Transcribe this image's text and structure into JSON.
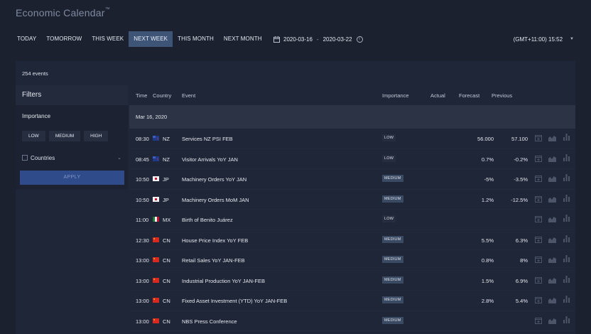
{
  "app": {
    "title": "Economic Calendar",
    "trademark": "™"
  },
  "period_tabs": [
    {
      "label": "TODAY",
      "active": false
    },
    {
      "label": "TOMORROW",
      "active": false
    },
    {
      "label": "THIS WEEK",
      "active": false
    },
    {
      "label": "NEXT WEEK",
      "active": true
    },
    {
      "label": "THIS MONTH",
      "active": false
    },
    {
      "label": "NEXT MONTH",
      "active": false
    }
  ],
  "date_range": {
    "start": "2020-03-16",
    "separator": "-",
    "end": "2020-03-22",
    "info_icon": "info-icon"
  },
  "timezone": {
    "label": "(GMT+11:00) 15:52"
  },
  "event_count": "254 events",
  "filters": {
    "title": "Filters",
    "importance_title": "Importance",
    "importance_buttons": [
      "LOW",
      "MEDIUM",
      "HIGH"
    ],
    "countries_label": "Countries",
    "apply_label": "APPLY"
  },
  "table": {
    "headers": {
      "time": "Time",
      "country": "Country",
      "event": "Event",
      "importance": "Importance",
      "actual": "Actual",
      "forecast": "Forecast",
      "previous": "Previous"
    },
    "date_group": "Mar 16, 2020",
    "rows": [
      {
        "time": "08:30",
        "flag": "nz-flag",
        "country": "NZ",
        "event": "Services NZ PSI FEB",
        "importance": "LOW",
        "actual": "",
        "forecast": "56.000",
        "previous": "57.100"
      },
      {
        "time": "08:45",
        "flag": "nz-flag",
        "country": "NZ",
        "event": "Visitor Arrivals YoY JAN",
        "importance": "LOW",
        "actual": "",
        "forecast": "0.7%",
        "previous": "-0.2%"
      },
      {
        "time": "10:50",
        "flag": "jp-flag",
        "country": "JP",
        "event": "Machinery Orders YoY JAN",
        "importance": "MEDIUM",
        "actual": "",
        "forecast": "-5%",
        "previous": "-3.5%"
      },
      {
        "time": "10:50",
        "flag": "jp-flag",
        "country": "JP",
        "event": "Machinery Orders MoM JAN",
        "importance": "MEDIUM",
        "actual": "",
        "forecast": "1.2%",
        "previous": "-12.5%"
      },
      {
        "time": "11:00",
        "flag": "mx-flag",
        "country": "MX",
        "event": "Birth of Benito Juárez",
        "importance": "LOW",
        "actual": "",
        "forecast": "",
        "previous": ""
      },
      {
        "time": "12:30",
        "flag": "cn-flag",
        "country": "CN",
        "event": "House Price Index YoY FEB",
        "importance": "MEDIUM",
        "actual": "",
        "forecast": "5.5%",
        "previous": "6.3%"
      },
      {
        "time": "13:00",
        "flag": "cn-flag",
        "country": "CN",
        "event": "Retail Sales YoY JAN-FEB",
        "importance": "MEDIUM",
        "actual": "",
        "forecast": "0.8%",
        "previous": "8%"
      },
      {
        "time": "13:00",
        "flag": "cn-flag",
        "country": "CN",
        "event": "Industrial Production YoY JAN-FEB",
        "importance": "MEDIUM",
        "actual": "",
        "forecast": "1.5%",
        "previous": "6.9%"
      },
      {
        "time": "13:00",
        "flag": "cn-flag",
        "country": "CN",
        "event": "Fixed Asset Investment (YTD) YoY JAN-FEB",
        "importance": "MEDIUM",
        "actual": "",
        "forecast": "2.8%",
        "previous": "5.4%"
      },
      {
        "time": "13:00",
        "flag": "cn-flag",
        "country": "CN",
        "event": "NBS Press Conference",
        "importance": "MEDIUM",
        "actual": "",
        "forecast": "",
        "previous": ""
      }
    ],
    "row_action_icons": [
      "calendar-add-icon",
      "area-chart-icon",
      "bar-chart-icon"
    ]
  },
  "colors": {
    "background": "#1b212f",
    "panel": "#1f2637",
    "active_tab": "#3f5578",
    "apply_button": "#2f4b8a",
    "medium_badge": "#3b4a63"
  }
}
